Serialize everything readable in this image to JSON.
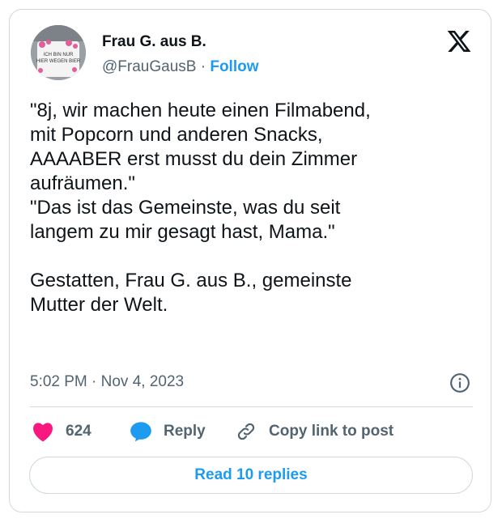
{
  "author": {
    "name": "Frau G. aus B.",
    "handle": "@FrauGausB",
    "separator": "·",
    "follow_label": "Follow",
    "avatar_mug_text": "ICH BIN NUR HIER WEGEN BIER"
  },
  "logo": {
    "icon": "x-logo-icon"
  },
  "tweet": {
    "text": "\"8j, wir machen heute einen Filmabend,\nmit Popcorn und anderen Snacks,\nAAAABER erst musst du dein Zimmer\naufräumen.\"\n\"Das ist das Gemeinste, was du seit\nlangem zu mir gesagt hast, Mama.\"\n\nGestatten, Frau G. aus B., gemeinste\nMutter der Welt.",
    "timestamp": "5:02 PM · Nov 4, 2023"
  },
  "actions": {
    "like_count": "624",
    "reply_label": "Reply",
    "copy_label": "Copy link to post"
  },
  "footer": {
    "read_replies_label": "Read 10 replies"
  },
  "colors": {
    "accent": "#1d9bf0",
    "like": "#f91880",
    "text": "#0f1419",
    "secondary": "#536471",
    "border": "#cfd9de"
  }
}
